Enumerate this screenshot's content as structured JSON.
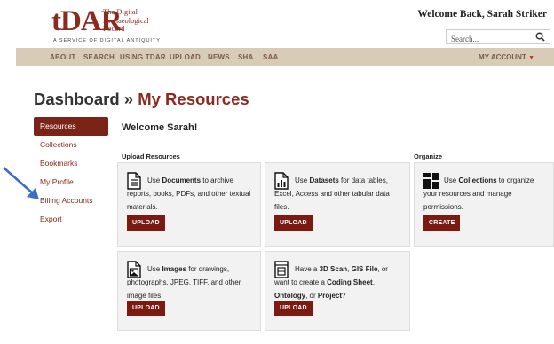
{
  "logo": {
    "mark": "tDAR",
    "lines": [
      "The Digital",
      "Archaeological",
      "Record"
    ],
    "tagline": "A SERVICE OF DIGITAL ANTIQUITY"
  },
  "header": {
    "welcome": "Welcome Back, Sarah Striker",
    "search_placeholder": "Search..."
  },
  "nav": {
    "items": [
      "ABOUT",
      "SEARCH",
      "USING TDAR",
      "UPLOAD",
      "NEWS",
      "SHA",
      "SAA"
    ],
    "account": "MY ACCOUNT"
  },
  "title": {
    "prefix": "Dashboard » ",
    "accent": "My Resources"
  },
  "sidebar": {
    "items": [
      {
        "label": "Resources",
        "active": true
      },
      {
        "label": "Collections"
      },
      {
        "label": "Bookmarks"
      },
      {
        "label": "My Profile"
      },
      {
        "label": "Billing Accounts"
      },
      {
        "label": "Export"
      }
    ]
  },
  "main": {
    "welcome": "Welcome Sarah!",
    "upload_heading": "Upload Resources",
    "organize_heading": "Organize",
    "cards": {
      "documents": {
        "pre": "Use ",
        "bold": "Documents",
        "post": " to archive",
        "line2": "reports, books, PDFs, and other textual",
        "line3": "materials.",
        "button": "UPLOAD"
      },
      "datasets": {
        "pre": "Use ",
        "bold": "Datasets",
        "post": " for data tables,",
        "line2": "Excel, Access and other tabular data",
        "line3": "files.",
        "button": "UPLOAD"
      },
      "collections": {
        "pre": "Use ",
        "bold": "Collections",
        "post": " to organize",
        "line2": "your resources and manage",
        "line3": "permissions.",
        "button": "CREATE"
      },
      "images": {
        "pre": "Use ",
        "bold": "Images",
        "post": " for drawings,",
        "line2": "photographs, JPEG, TIFF, and other",
        "line3": "image files.",
        "button": "UPLOAD"
      },
      "other": {
        "pre": "Have a ",
        "bold": "3D Scan",
        "mid": ", ",
        "bold2": "GIS File",
        "post": ", or",
        "line2pre": "want to create a ",
        "line2bold": "Coding Sheet",
        "line2post": ",",
        "line3bold": "Ontology",
        "line3mid": ", or ",
        "line3bold2": "Project",
        "line3post": "?",
        "button": "UPLOAD"
      }
    }
  },
  "colors": {
    "brand": "#8b2a1f",
    "button": "#7a1a10",
    "nav_bg": "#d9ccb6",
    "arrow": "#3b6fc6"
  }
}
